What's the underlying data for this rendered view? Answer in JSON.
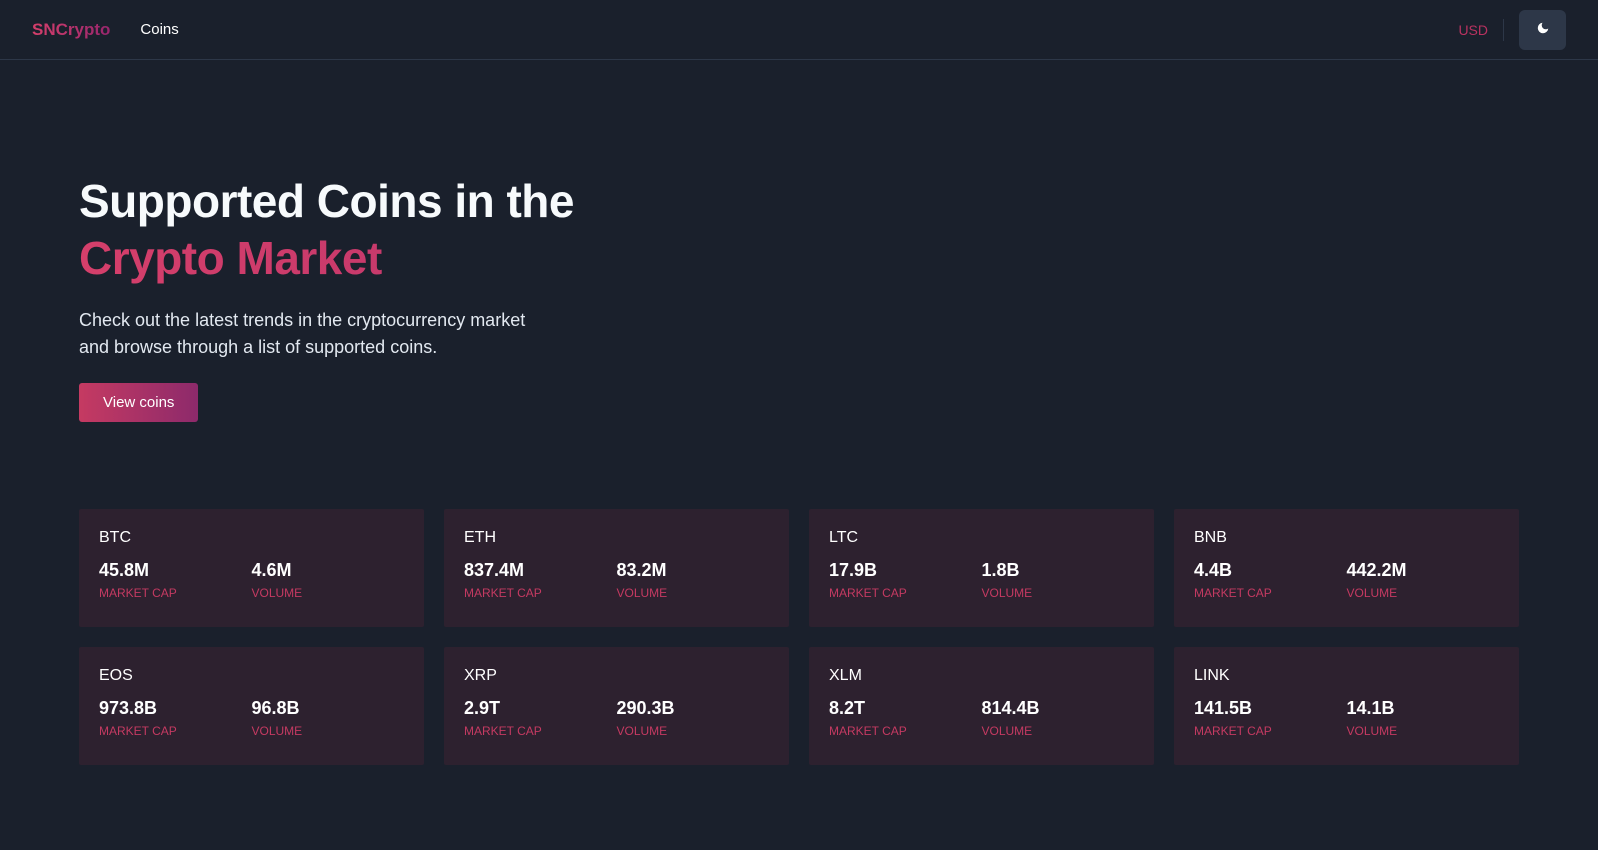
{
  "navbar": {
    "brand": "SNCrypto",
    "links": [
      {
        "label": "Coins"
      }
    ],
    "currency": "USD",
    "theme_icon": "moon-icon"
  },
  "hero": {
    "title_line1": "Supported Coins in the",
    "title_line2": "Crypto Market",
    "description": "Check out the latest trends in the cryptocurrency market and browse through a list of supported coins.",
    "button_label": "View coins"
  },
  "labels": {
    "market_cap": "MARKET CAP",
    "volume": "VOLUME"
  },
  "coins": [
    {
      "symbol": "BTC",
      "market_cap": "45.8M",
      "volume": "4.6M"
    },
    {
      "symbol": "ETH",
      "market_cap": "837.4M",
      "volume": "83.2M"
    },
    {
      "symbol": "LTC",
      "market_cap": "17.9B",
      "volume": "1.8B"
    },
    {
      "symbol": "BNB",
      "market_cap": "4.4B",
      "volume": "442.2M"
    },
    {
      "symbol": "EOS",
      "market_cap": "973.8B",
      "volume": "96.8B"
    },
    {
      "symbol": "XRP",
      "market_cap": "2.9T",
      "volume": "290.3B"
    },
    {
      "symbol": "XLM",
      "market_cap": "8.2T",
      "volume": "814.4B"
    },
    {
      "symbol": "LINK",
      "market_cap": "141.5B",
      "volume": "14.1B"
    }
  ],
  "colors": {
    "accent_start": "#d53f6b",
    "accent_end": "#97266d",
    "background": "#1a202c",
    "card": "#2d212f"
  }
}
